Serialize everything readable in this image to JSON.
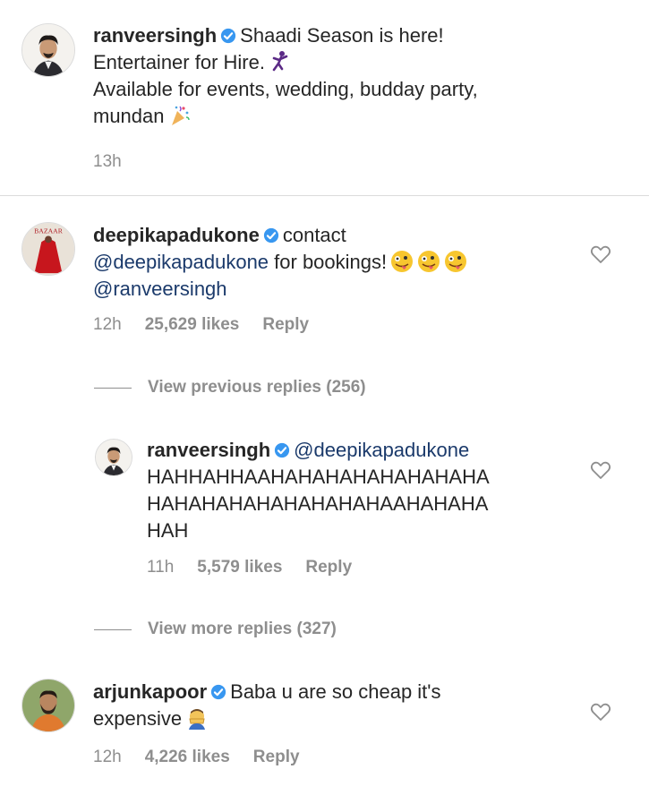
{
  "post": {
    "username": "ranveersingh",
    "line1": "Shaadi Season is here!",
    "line2": "Entertainer for Hire.",
    "line3": "Available for events, wedding, budday party,",
    "line4": "mundan",
    "time": "13h"
  },
  "comments": [
    {
      "username": "deepikapadukone",
      "text_start": "contact",
      "mention1": "@deepikapadukone",
      "text_mid": " for bookings!",
      "mention2": "@ranveersingh",
      "time": "12h",
      "likes": "25,629 likes",
      "reply": "Reply",
      "avatar_text": "BAZAAR"
    },
    {
      "username": "ranveersingh",
      "mention": "@deepikapadukone",
      "line1": "HAHHAHHAAHAHAHAHAHAHAHAHA",
      "line2": "HAHAHAHAHAHAHAHAHAAHAHAHA",
      "line3": "HAH",
      "time": "11h",
      "likes": "5,579 likes",
      "reply": "Reply"
    },
    {
      "username": "arjunkapoor",
      "line1": "Baba u are so cheap it's",
      "line2": "expensive",
      "time": "12h",
      "likes": "4,226 likes",
      "reply": "Reply"
    }
  ],
  "view_previous_replies": "View previous replies (256)",
  "view_more_replies": "View more replies (327)",
  "icons": {
    "verified": "verified-badge-icon",
    "heart": "heart-outline-icon",
    "dancer_emoji": "dancing-man-emoji",
    "confetti_emoji": "confetti-emoji",
    "zany_emoji": "zany-face-emoji",
    "facepalm_emoji": "facepalm-emoji"
  },
  "colors": {
    "verified_blue": "#3897f0",
    "meta_gray": "#8e8e8e",
    "text": "#262626"
  }
}
